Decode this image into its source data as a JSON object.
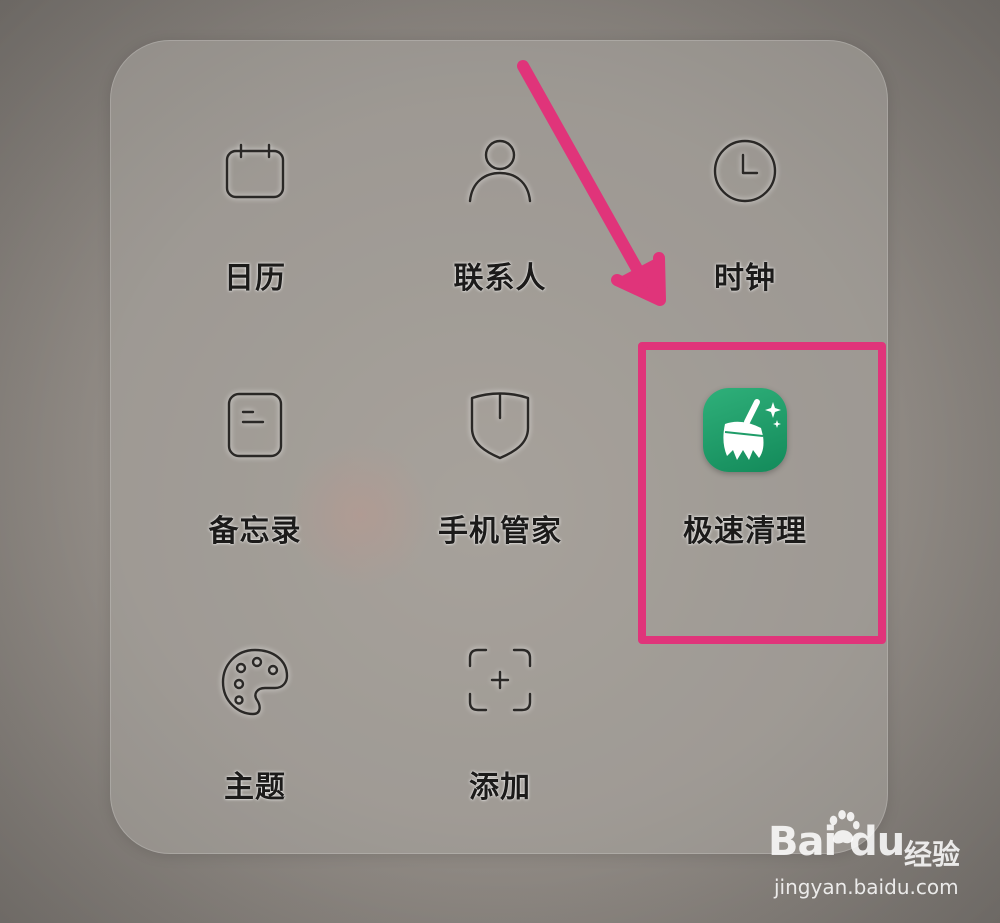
{
  "apps": [
    {
      "id": "calendar",
      "label": "日历",
      "icon": "calendar-icon"
    },
    {
      "id": "contacts",
      "label": "联系人",
      "icon": "person-icon"
    },
    {
      "id": "clock",
      "label": "时钟",
      "icon": "clock-icon"
    },
    {
      "id": "notes",
      "label": "备忘录",
      "icon": "note-icon"
    },
    {
      "id": "phone-manager",
      "label": "手机管家",
      "icon": "shield-icon"
    },
    {
      "id": "quick-clean",
      "label": "极速清理",
      "icon": "broom-icon",
      "icon_color": "#1f9c68"
    },
    {
      "id": "themes",
      "label": "主题",
      "icon": "palette-icon"
    },
    {
      "id": "add",
      "label": "添加",
      "icon": "add-frame-icon"
    }
  ],
  "annotation": {
    "highlight_color": "#e0347a",
    "arrow_color": "#e0347a",
    "target": "quick-clean"
  },
  "watermark": {
    "logo_text": "Bai du",
    "logo_cn": "经验",
    "url": "jingyan.baidu.com"
  }
}
